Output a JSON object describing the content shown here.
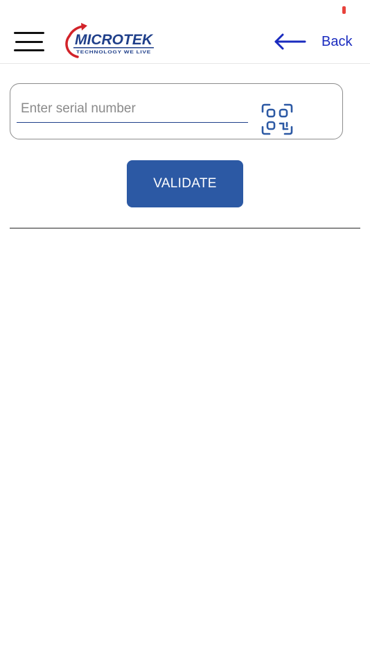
{
  "status_bar": {
    "indicator_color": "#e8423b"
  },
  "header": {
    "menu_icon": "hamburger-menu-icon",
    "logo": {
      "brand": "MICROTEK",
      "tagline": "TECHNOLOGY WE LIVE",
      "brand_color": "#1f3f8a",
      "accent_color": "#d2232a"
    },
    "back": {
      "icon": "arrow-left-icon",
      "label": "Back",
      "color": "#1a2bbf"
    }
  },
  "serial": {
    "placeholder": "Enter serial number",
    "value": "",
    "scan_icon": "qr-code-scan-icon"
  },
  "validate": {
    "label": "VALIDATE",
    "color": "#2c59a4"
  }
}
